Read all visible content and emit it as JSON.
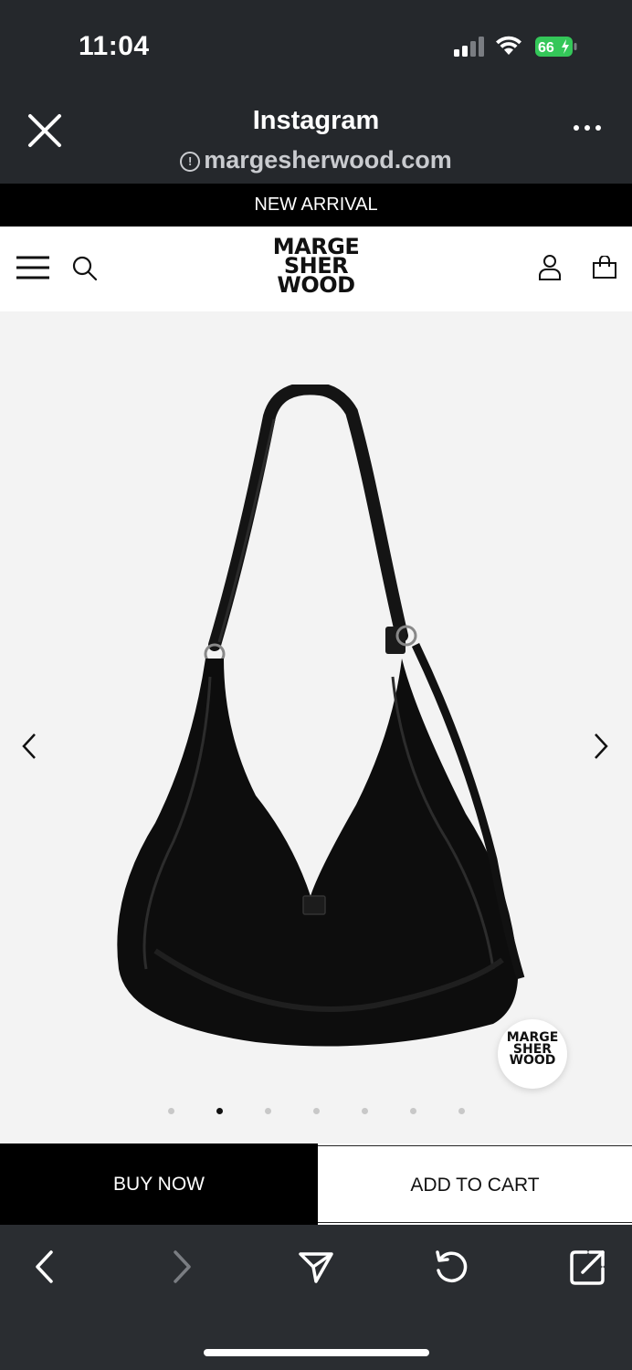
{
  "status_bar": {
    "time": "11:04",
    "battery": "66"
  },
  "browser_header": {
    "title": "Instagram",
    "url": "margesherwood.com"
  },
  "announcement": "NEW ARRIVAL",
  "logo": {
    "line1": "MARGE",
    "line2": "SHER",
    "line3": "WOOD"
  },
  "badge": {
    "line1": "MARGE",
    "line2": "SHER",
    "line3": "WOOD"
  },
  "carousel": {
    "total": 7,
    "active_index": 1
  },
  "actions": {
    "buy_now": "BUY NOW",
    "add_to_cart": "ADD TO CART"
  },
  "colors": {
    "header_bg": "#25282c",
    "announcement_bg": "#000000",
    "product_bg": "#f3f3f3",
    "battery": "#34c759"
  },
  "icons": [
    "close-icon",
    "more-icon",
    "menu-icon",
    "search-icon",
    "user-icon",
    "shopping-bag-icon",
    "chevron-left-icon",
    "chevron-right-icon",
    "back-icon",
    "forward-icon",
    "share-icon",
    "reload-icon",
    "open-external-icon"
  ]
}
